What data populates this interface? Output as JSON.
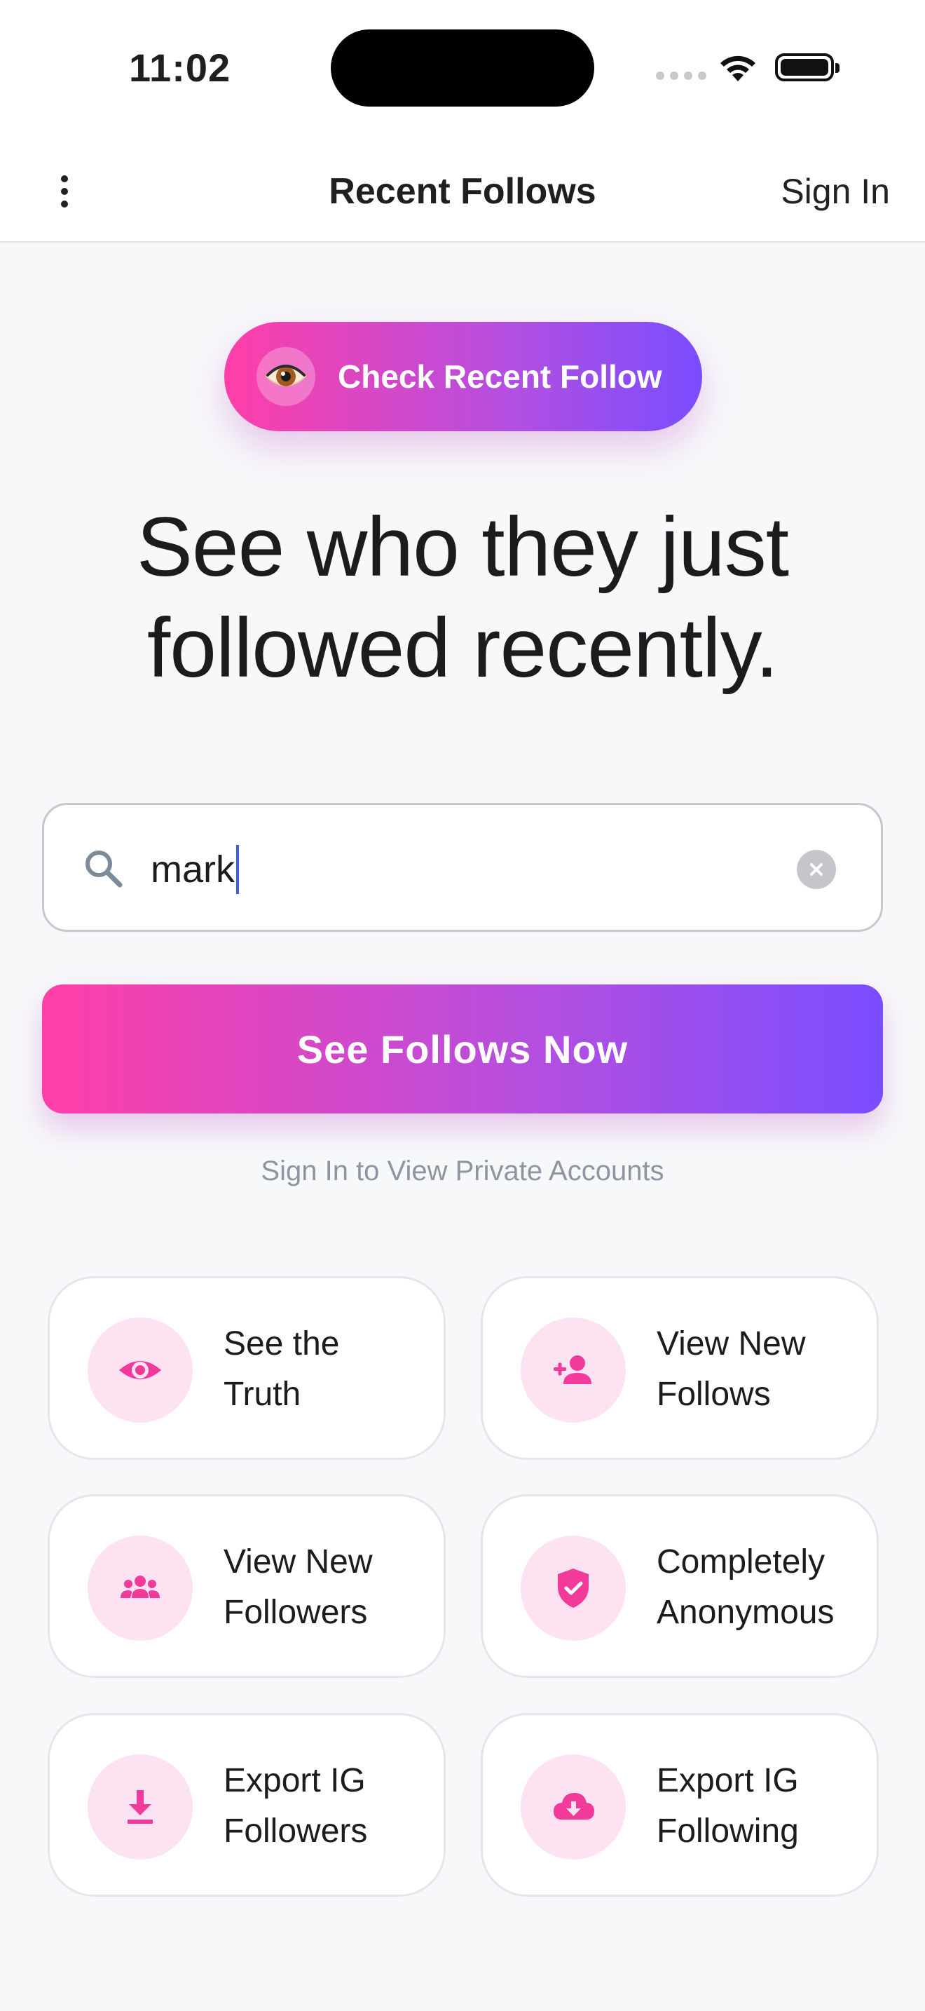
{
  "status_bar": {
    "time": "11:02"
  },
  "nav": {
    "title": "Recent Follows",
    "sign_in_label": "Sign In"
  },
  "pill_button": {
    "label": "Check Recent Follow",
    "icon": "eye-emoji"
  },
  "headline": {
    "line1": "See who they just",
    "line2": "followed recently."
  },
  "search": {
    "value": "mark"
  },
  "cta": {
    "label": "See Follows Now",
    "subtext": "Sign In to View Private Accounts"
  },
  "features": [
    {
      "label_line1": "See the",
      "label_line2": "Truth",
      "icon": "eye-icon"
    },
    {
      "label_line1": "View New",
      "label_line2": "Follows",
      "icon": "person-add-icon"
    },
    {
      "label_line1": "View New",
      "label_line2": "Followers",
      "icon": "group-icon"
    },
    {
      "label_line1": "Completely",
      "label_line2": "Anonymous",
      "icon": "shield-check-icon"
    },
    {
      "label_line1": "Export IG",
      "label_line2": "Followers",
      "icon": "download-icon"
    },
    {
      "label_line1": "Export IG",
      "label_line2": "Following",
      "icon": "cloud-download-icon"
    }
  ],
  "colors": {
    "accent_pink": "#ff3fa8",
    "accent_purple": "#7a4dff",
    "icon_pink": "#f23a9a",
    "icon_bg": "#fde3f1",
    "background": "#f7f8fa"
  }
}
